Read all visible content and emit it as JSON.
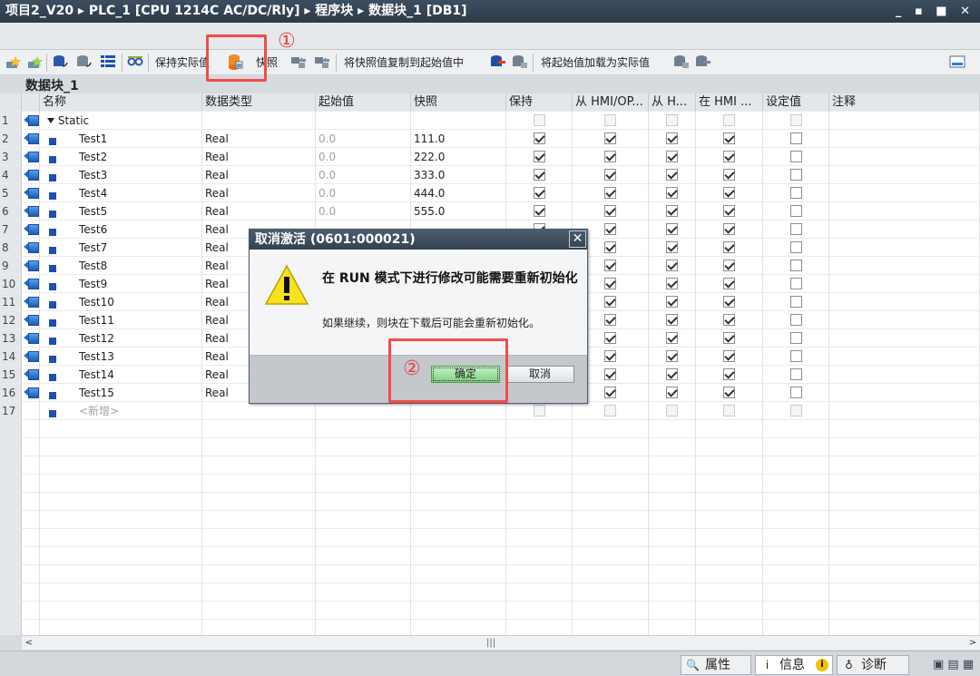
{
  "window": {
    "breadcrumb": "项目2_V20 ▸ PLC_1 [CPU 1214C AC/DC/Rly] ▸ 程序块 ▸ 数据块_1 [DB1]",
    "controls": "_ ▪ ■ ✕"
  },
  "toolbar": {
    "keep_actual_label": "保持实际值",
    "snapshot_label": "快照",
    "copy_snapshot_label": "将快照值复制到起始值中",
    "load_start_label": "将起始值加载为实际值"
  },
  "block_title": "数据块_1",
  "table": {
    "headers": [
      "名称",
      "数据类型",
      "起始值",
      "快照",
      "保持",
      "从 HMI/OP...",
      "从 H...",
      "在 HMI ...",
      "设定值",
      "注释"
    ],
    "static_name": "Static",
    "new_row_label": "<新增>",
    "rows": [
      {
        "num": "1",
        "name": "Static",
        "type": "",
        "start": "",
        "snapshot": "",
        "retain": false,
        "acc1": false,
        "acc2": false,
        "vis": false,
        "setpoint": false
      },
      {
        "num": "2",
        "name": "Test1",
        "type": "Real",
        "start": "0.0",
        "snapshot": "111.0",
        "retain": true,
        "acc1": true,
        "acc2": true,
        "vis": true,
        "setpoint": false
      },
      {
        "num": "3",
        "name": "Test2",
        "type": "Real",
        "start": "0.0",
        "snapshot": "222.0",
        "retain": true,
        "acc1": true,
        "acc2": true,
        "vis": true,
        "setpoint": false
      },
      {
        "num": "4",
        "name": "Test3",
        "type": "Real",
        "start": "0.0",
        "snapshot": "333.0",
        "retain": true,
        "acc1": true,
        "acc2": true,
        "vis": true,
        "setpoint": false
      },
      {
        "num": "5",
        "name": "Test4",
        "type": "Real",
        "start": "0.0",
        "snapshot": "444.0",
        "retain": true,
        "acc1": true,
        "acc2": true,
        "vis": true,
        "setpoint": false
      },
      {
        "num": "6",
        "name": "Test5",
        "type": "Real",
        "start": "0.0",
        "snapshot": "555.0",
        "retain": true,
        "acc1": true,
        "acc2": true,
        "vis": true,
        "setpoint": false
      },
      {
        "num": "7",
        "name": "Test6",
        "type": "Real",
        "start": "",
        "snapshot": "",
        "retain": true,
        "acc1": true,
        "acc2": true,
        "vis": true,
        "setpoint": false
      },
      {
        "num": "8",
        "name": "Test7",
        "type": "Real",
        "start": "",
        "snapshot": "",
        "retain": true,
        "acc1": true,
        "acc2": true,
        "vis": true,
        "setpoint": false
      },
      {
        "num": "9",
        "name": "Test8",
        "type": "Real",
        "start": "",
        "snapshot": "",
        "retain": true,
        "acc1": true,
        "acc2": true,
        "vis": true,
        "setpoint": false
      },
      {
        "num": "10",
        "name": "Test9",
        "type": "Real",
        "start": "",
        "snapshot": "",
        "retain": true,
        "acc1": true,
        "acc2": true,
        "vis": true,
        "setpoint": false
      },
      {
        "num": "11",
        "name": "Test10",
        "type": "Real",
        "start": "",
        "snapshot": "",
        "retain": true,
        "acc1": true,
        "acc2": true,
        "vis": true,
        "setpoint": false
      },
      {
        "num": "12",
        "name": "Test11",
        "type": "Real",
        "start": "",
        "snapshot": "",
        "retain": true,
        "acc1": true,
        "acc2": true,
        "vis": true,
        "setpoint": false
      },
      {
        "num": "13",
        "name": "Test12",
        "type": "Real",
        "start": "",
        "snapshot": "",
        "retain": true,
        "acc1": true,
        "acc2": true,
        "vis": true,
        "setpoint": false
      },
      {
        "num": "14",
        "name": "Test13",
        "type": "Real",
        "start": "",
        "snapshot": "",
        "retain": true,
        "acc1": true,
        "acc2": true,
        "vis": true,
        "setpoint": false
      },
      {
        "num": "15",
        "name": "Test14",
        "type": "Real",
        "start": "",
        "snapshot": "",
        "retain": true,
        "acc1": true,
        "acc2": true,
        "vis": true,
        "setpoint": false
      },
      {
        "num": "16",
        "name": "Test15",
        "type": "Real",
        "start": "",
        "snapshot": "",
        "retain": true,
        "acc1": true,
        "acc2": true,
        "vis": true,
        "setpoint": false
      },
      {
        "num": "17",
        "name": "<新增>",
        "type": "",
        "start": "",
        "snapshot": "",
        "retain": false,
        "acc1": false,
        "acc2": false,
        "vis": false,
        "setpoint": false
      }
    ]
  },
  "dialog": {
    "title": "取消激活 (0601:000021)",
    "message_main": "在 RUN 模式下进行修改可能需要重新初始化",
    "message_detail": "如果继续，则块在下载后可能会重新初始化。",
    "ok_label": "确定",
    "cancel_label": "取消"
  },
  "annotations": {
    "step1": "①",
    "step2": "②"
  },
  "statusbar": {
    "properties_label": "属性",
    "info_label": "信息",
    "diagnostics_label": "诊断"
  },
  "colors": {
    "annotation": "#f44a4a",
    "titlebar": "#34424f",
    "ok_button": "#7fcf7f"
  }
}
